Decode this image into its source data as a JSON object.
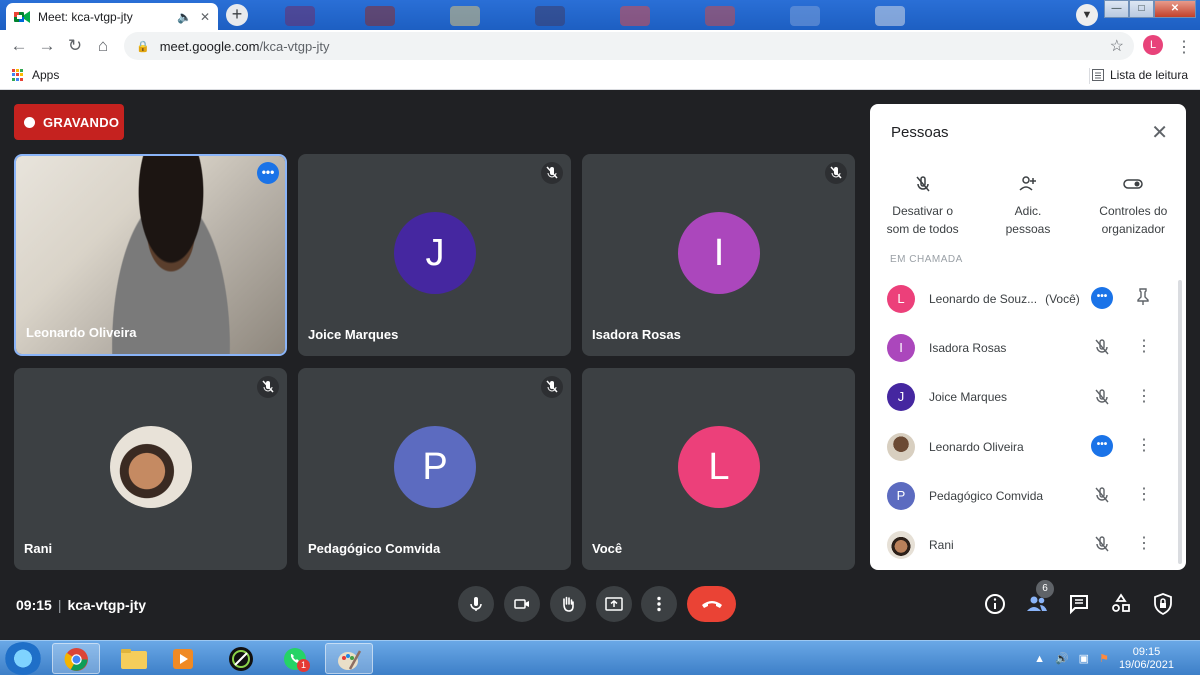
{
  "browser": {
    "tab_title": "Meet: kca-vtgp-jty",
    "url_host": "meet.google.com",
    "url_path": "/kca-vtgp-jty",
    "profile_initial": "L",
    "bookmarks": {
      "apps_label": "Apps",
      "reading_list_label": "Lista de leitura"
    }
  },
  "meeting": {
    "recording_label": "GRAVANDO",
    "time": "09:15",
    "code": "kca-vtgp-jty",
    "participants_badge": "6"
  },
  "tiles": [
    {
      "name": "Leonardo Oliveira"
    },
    {
      "name": "Joice Marques",
      "initial": "J",
      "color": "#4527a0"
    },
    {
      "name": "Isadora Rosas",
      "initial": "I",
      "color": "#ab47bc"
    },
    {
      "name": "Rani"
    },
    {
      "name": "Pedagógico Comvida",
      "initial": "P",
      "color": "#5c6bc0"
    },
    {
      "name": "Você",
      "initial": "L",
      "color": "#ec407a"
    }
  ],
  "people_panel": {
    "title": "Pessoas",
    "actions": [
      {
        "label_1": "Desativar o",
        "label_2": "som de todos"
      },
      {
        "label_1": "Adic.",
        "label_2": "pessoas"
      },
      {
        "label_1": "Controles do",
        "label_2": "organizador"
      }
    ],
    "partially_hidden_label": "EM CHAMADA",
    "people": [
      {
        "name": "Leonardo de Souz...",
        "suffix": "(Você)",
        "initial": "L",
        "color": "#ec407a"
      },
      {
        "name": "Isadora Rosas",
        "initial": "I",
        "color": "#ab47bc"
      },
      {
        "name": "Joice Marques",
        "initial": "J",
        "color": "#4527a0"
      },
      {
        "name": "Leonardo Oliveira",
        "initial": ""
      },
      {
        "name": "Pedagógico Comvida",
        "initial": "P",
        "color": "#5c6bc0"
      },
      {
        "name": "Rani",
        "initial": ""
      }
    ]
  },
  "taskbar": {
    "time": "09:15",
    "date": "19/06/2021",
    "whatsapp_badge": "1"
  }
}
